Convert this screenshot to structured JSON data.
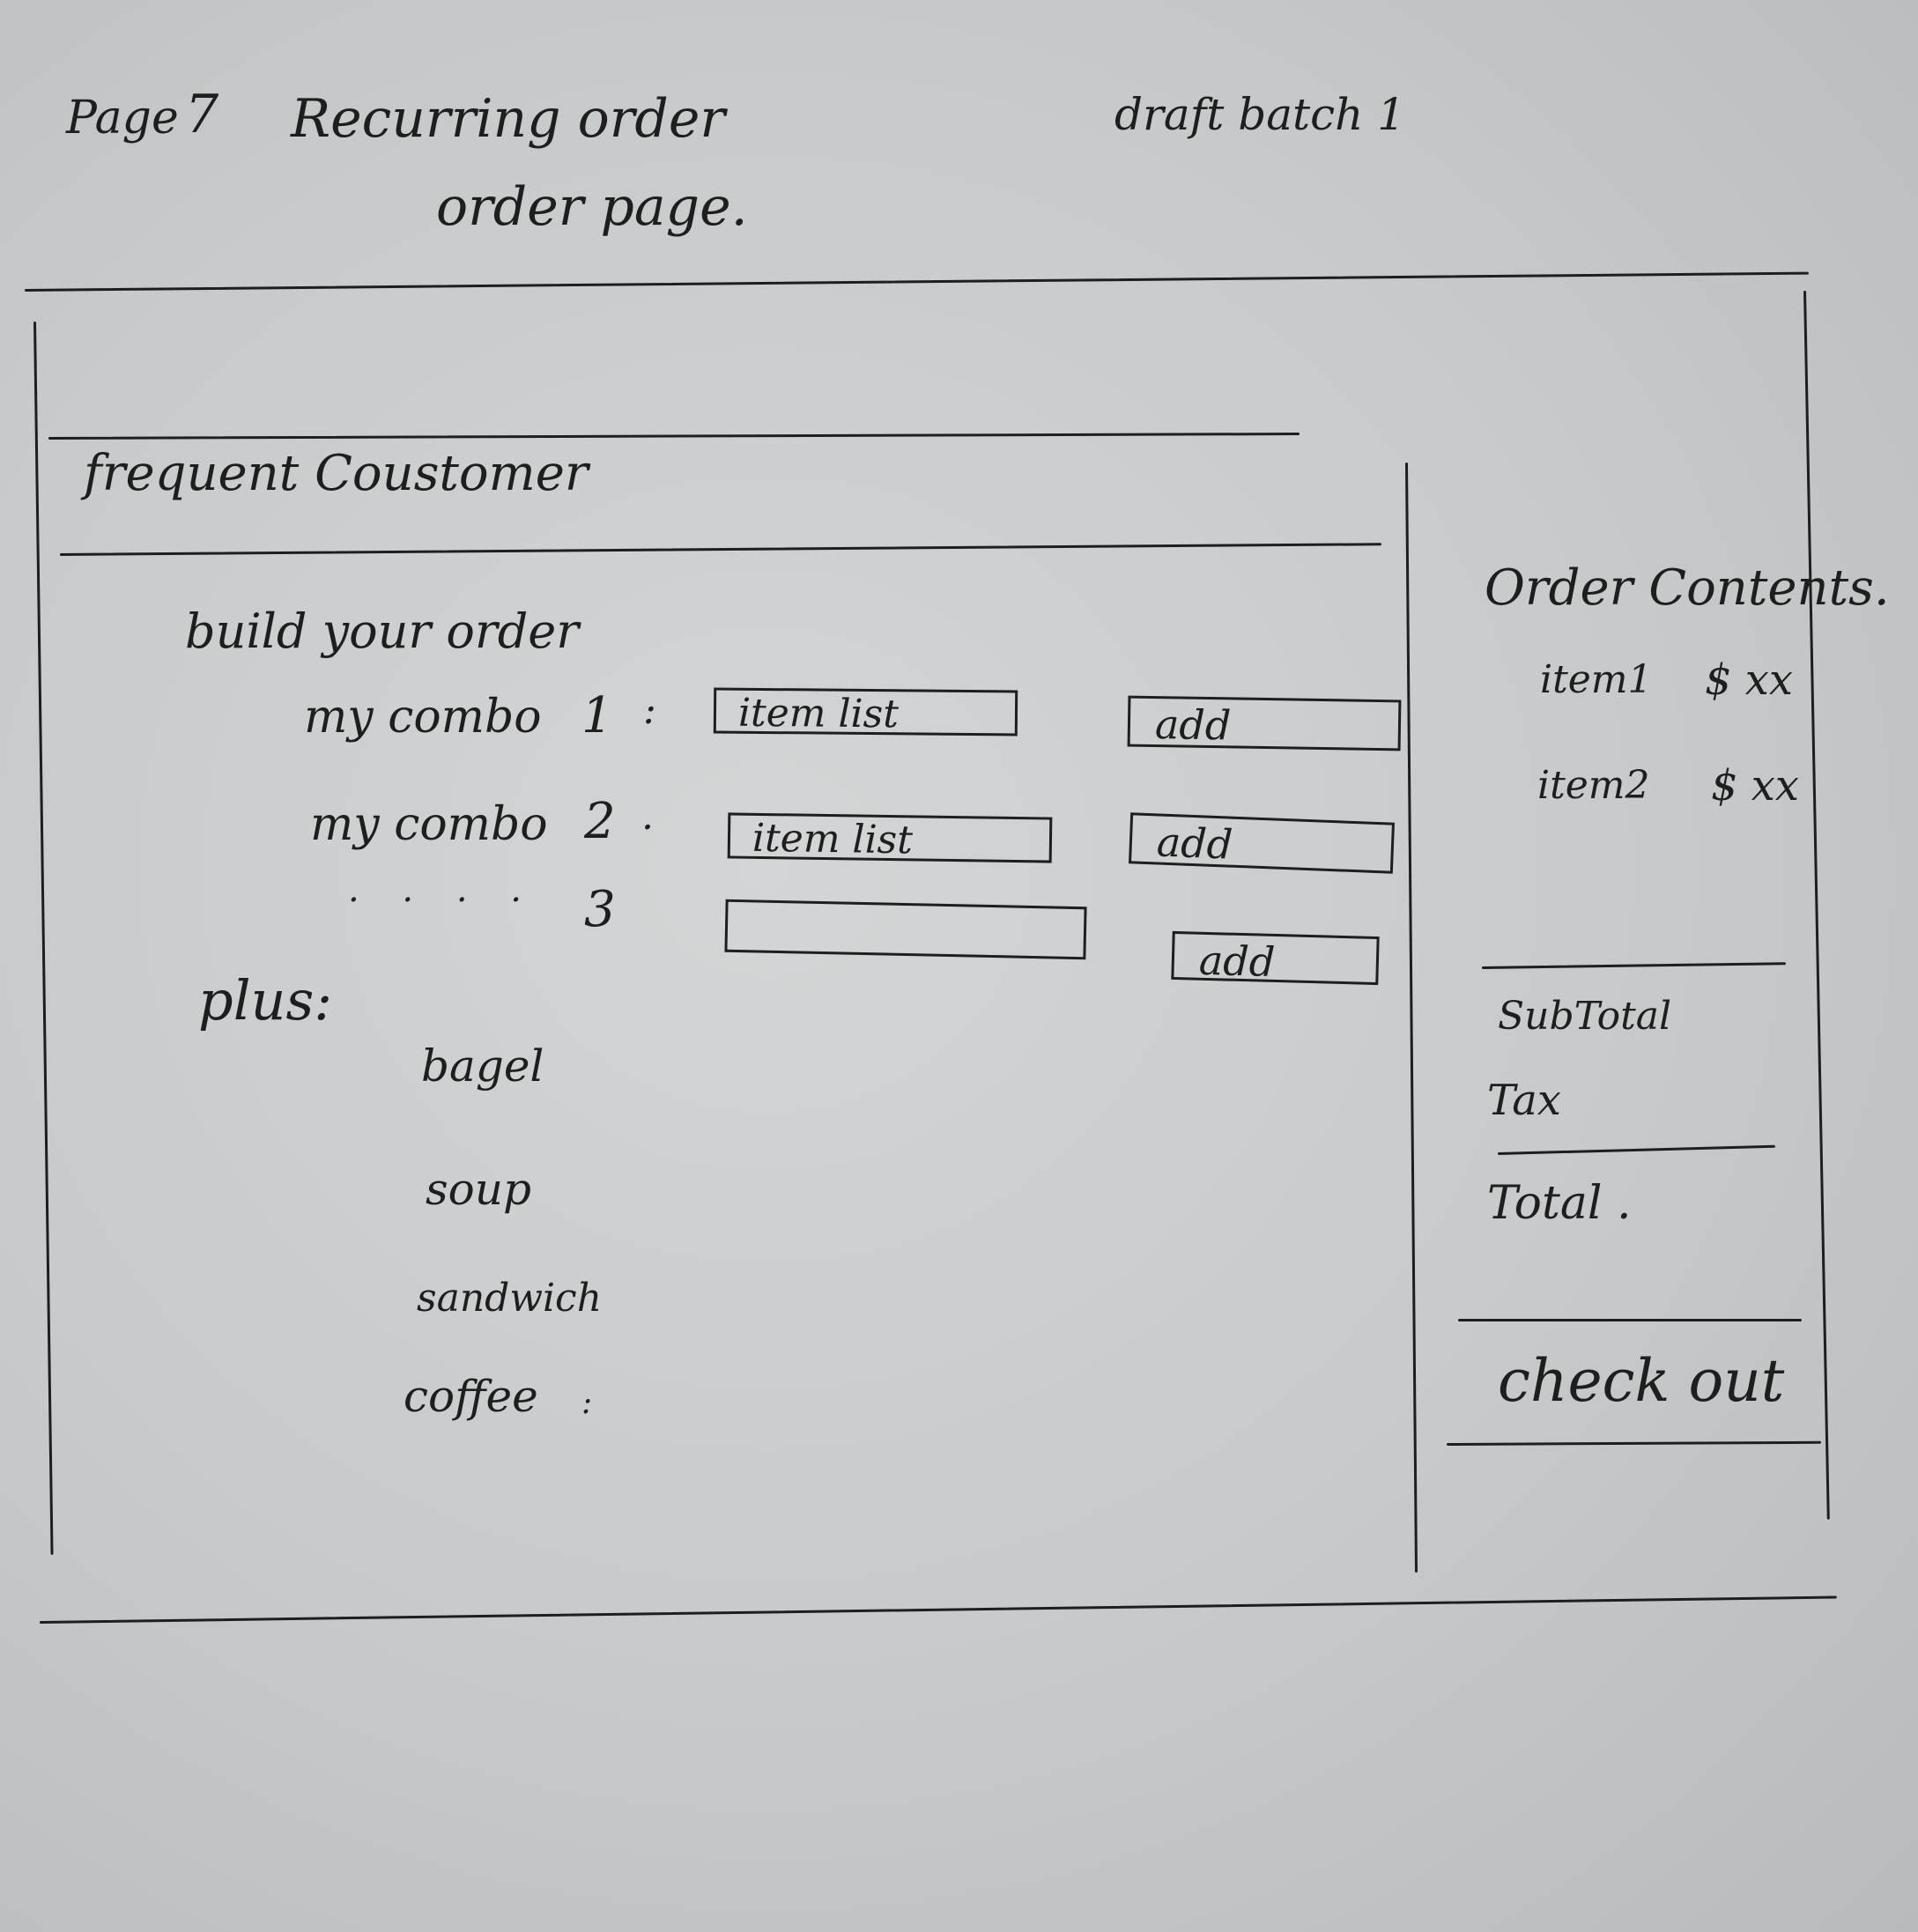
{
  "header": {
    "page_label": "Page",
    "page_number": "7",
    "title": "Recurring order",
    "subtitle": "order page.",
    "draft_note": "draft batch 1"
  },
  "main": {
    "section_title": "frequent Coustomer",
    "build_title": "build your order",
    "combos": [
      {
        "label": "my combo",
        "number": "1",
        "separator": ":",
        "field_text": "item list",
        "add_label": "add"
      },
      {
        "label": "my combo",
        "number": "2",
        "separator": ".",
        "field_text": "item list",
        "add_label": "add"
      },
      {
        "label": ". . . .",
        "number": "3",
        "separator": "",
        "field_text": "",
        "add_label": "add"
      }
    ],
    "plus_title": "plus:",
    "plus_items": [
      "bagel",
      "soup",
      "sandwich",
      "coffee"
    ],
    "plus_trailing": ":"
  },
  "sidebar": {
    "title": "Order Contents.",
    "items": [
      {
        "name": "item1",
        "price": "$ xx"
      },
      {
        "name": "item2",
        "price": "$ xx"
      }
    ],
    "subtotal_label": "SubTotal",
    "tax_label": "Tax",
    "total_label": "Total .",
    "checkout_label": "check out"
  }
}
